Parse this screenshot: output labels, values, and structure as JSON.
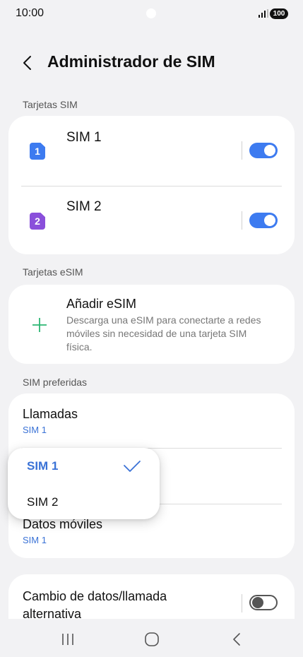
{
  "status_bar": {
    "time": "10:00",
    "battery": "100"
  },
  "header": {
    "title": "Administrador de SIM"
  },
  "sections": {
    "sim_cards": "Tarjetas SIM",
    "esim_cards": "Tarjetas eSIM",
    "preferred": "SIM preferidas"
  },
  "sim_cards": [
    {
      "badge": "1",
      "name": "SIM 1",
      "enabled": true,
      "color": "#3d7bf0"
    },
    {
      "badge": "2",
      "name": "SIM 2",
      "enabled": true,
      "color": "#8a4fdb"
    }
  ],
  "esim": {
    "title": "Añadir eSIM",
    "desc_line1": "Descarga una eSIM para conectarte a redes",
    "desc_line2": "móviles sin necesidad de una tarjeta SIM",
    "desc_line3": "física."
  },
  "preferred": {
    "calls_title": "Llamadas",
    "calls_value": "SIM 1",
    "data_title": "Datos móviles",
    "data_value": "SIM 1"
  },
  "popup": {
    "options": [
      "SIM 1",
      "SIM 2"
    ],
    "selected": "SIM 1"
  },
  "alt_switch": {
    "line1": "Cambio de datos/llamada",
    "line2": "alternativa",
    "enabled": false
  },
  "colors": {
    "accent": "#3d7bf0",
    "esim_plus": "#2bb673",
    "background": "#f2f2f4"
  },
  "icons": [
    "signal-icon",
    "back-chevron-icon",
    "sim-card-icon",
    "plus-icon",
    "checkmark-icon",
    "recents-icon",
    "home-icon",
    "nav-back-icon"
  ]
}
